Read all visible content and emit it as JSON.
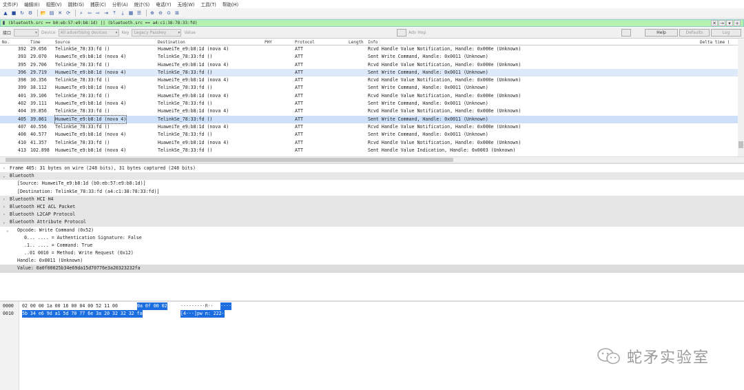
{
  "menu": [
    "文件(F)",
    "编辑(E)",
    "视图(V)",
    "跳转(G)",
    "捕获(C)",
    "分析(A)",
    "统计(S)",
    "电话(Y)",
    "无线(W)",
    "工具(T)",
    "帮助(H)"
  ],
  "filter": {
    "text": "(bluetooth.src == b0:eb:57:e9:b8:1d) || (bluetooth.src == a4:c1:38:78:33:fd)"
  },
  "btbar": {
    "interface_label": "接口",
    "device_label": "Device",
    "device_value": "All advertising devices",
    "key_label": "Key",
    "key_value": "Legacy Passkey",
    "value_label": "Value",
    "adv_hop_label": "Adv Hop",
    "help_label": "Help",
    "defaults_label": "Defaults",
    "log_label": "Log"
  },
  "columns": {
    "no": "No.",
    "time": "Time",
    "source": "Source",
    "destination": "Destination",
    "phy": "PHY",
    "protocol": "Protocol",
    "length": "Length",
    "info": "Info",
    "delta": "Delta time ("
  },
  "packets": [
    {
      "no": "392",
      "time": "29.056",
      "src": "TelinkSe_78:33:fd ()",
      "dst": "HuaweiTe_e9:b8:1d (nova 4)",
      "proto": "ATT",
      "info": "Rcvd Handle Value Notification, Handle: 0x000e (Unknown)",
      "state": "normal"
    },
    {
      "no": "393",
      "time": "29.070",
      "src": "HuaweiTe_e9:b8:1d (nova 4)",
      "dst": "TelinkSe_78:33:fd ()",
      "proto": "ATT",
      "info": "Sent Write Command, Handle: 0x0011 (Unknown)",
      "state": "normal"
    },
    {
      "no": "395",
      "time": "29.706",
      "src": "TelinkSe_78:33:fd ()",
      "dst": "HuaweiTe_e9:b8:1d (nova 4)",
      "proto": "ATT",
      "info": "Rcvd Handle Value Notification, Handle: 0x000e (Unknown)",
      "state": "normal"
    },
    {
      "no": "396",
      "time": "29.719",
      "src": "HuaweiTe_e9:b8:1d (nova 4)",
      "dst": "TelinkSe_78:33:fd ()",
      "proto": "ATT",
      "info": "Sent Write Command, Handle: 0x0011 (Unknown)",
      "state": "related"
    },
    {
      "no": "398",
      "time": "30.356",
      "src": "TelinkSe_78:33:fd ()",
      "dst": "HuaweiTe_e9:b8:1d (nova 4)",
      "proto": "ATT",
      "info": "Rcvd Handle Value Notification, Handle: 0x000e (Unknown)",
      "state": "normal"
    },
    {
      "no": "399",
      "time": "38.112",
      "src": "HuaweiTe_e9:b8:1d (nova 4)",
      "dst": "TelinkSe_78:33:fd ()",
      "proto": "ATT",
      "info": "Sent Write Command, Handle: 0x0011 (Unknown)",
      "state": "normal"
    },
    {
      "no": "401",
      "time": "39.106",
      "src": "TelinkSe_78:33:fd ()",
      "dst": "HuaweiTe_e9:b8:1d (nova 4)",
      "proto": "ATT",
      "info": "Rcvd Handle Value Notification, Handle: 0x000e (Unknown)",
      "state": "normal"
    },
    {
      "no": "402",
      "time": "39.111",
      "src": "HuaweiTe_e9:b8:1d (nova 4)",
      "dst": "TelinkSe_78:33:fd ()",
      "proto": "ATT",
      "info": "Sent Write Command, Handle: 0x0011 (Unknown)",
      "state": "normal"
    },
    {
      "no": "404",
      "time": "39.856",
      "src": "TelinkSe_78:33:fd ()",
      "dst": "HuaweiTe_e9:b8:1d (nova 4)",
      "proto": "ATT",
      "info": "Rcvd Handle Value Notification, Handle: 0x000e (Unknown)",
      "state": "normal"
    },
    {
      "no": "405",
      "time": "39.861",
      "src": "HuaweiTe_e9:b8:1d (nova 4)",
      "dst": "TelinkSe_78:33:fd ()",
      "proto": "ATT",
      "info": "Sent Write Command, Handle: 0x0011 (Unknown)",
      "state": "selected"
    },
    {
      "no": "407",
      "time": "40.556",
      "src": "TelinkSe_78:33:fd ()",
      "dst": "HuaweiTe_e9:b8:1d (nova 4)",
      "proto": "ATT",
      "info": "Rcvd Handle Value Notification, Handle: 0x000e (Unknown)",
      "state": "normal"
    },
    {
      "no": "408",
      "time": "40.577",
      "src": "HuaweiTe_e9:b8:1d (nova 4)",
      "dst": "TelinkSe_78:33:fd ()",
      "proto": "ATT",
      "info": "Sent Write Command, Handle: 0x0011 (Unknown)",
      "state": "normal"
    },
    {
      "no": "410",
      "time": "41.357",
      "src": "TelinkSe_78:33:fd ()",
      "dst": "HuaweiTe_e9:b8:1d (nova 4)",
      "proto": "ATT",
      "info": "Rcvd Handle Value Notification, Handle: 0x000e (Unknown)",
      "state": "normal"
    },
    {
      "no": "413",
      "time": "102.898",
      "src": "HuaweiTe_e9:b8:1d (nova 4)",
      "dst": "TelinkSe_78:33:fd ()",
      "proto": "ATT",
      "info": "Sent Handle Value Indication, Handle: 0x0003 (Unknown)",
      "state": "normal"
    }
  ],
  "details": [
    {
      "text": "Frame 405: 31 bytes on wire (248 bits), 31 bytes captured (248 bits)",
      "indent": 0,
      "arrow": ">",
      "style": "normal"
    },
    {
      "text": "Bluetooth",
      "indent": 0,
      "arrow": "v",
      "style": "hl"
    },
    {
      "text": "[Source: HuaweiTe_e9:b8:1d (b0:eb:57:e9:b8:1d)]",
      "indent": 1,
      "arrow": "",
      "style": "normal"
    },
    {
      "text": "[Destination: TelinkSe_78:33:fd (a4:c1:38:78:33:fd)]",
      "indent": 1,
      "arrow": "",
      "style": "normal"
    },
    {
      "text": "Bluetooth HCI H4",
      "indent": 0,
      "arrow": ">",
      "style": "hl"
    },
    {
      "text": "Bluetooth HCI ACL Packet",
      "indent": 0,
      "arrow": ">",
      "style": "hl"
    },
    {
      "text": "Bluetooth L2CAP Protocol",
      "indent": 0,
      "arrow": ">",
      "style": "hl"
    },
    {
      "text": "Bluetooth Attribute Protocol",
      "indent": 0,
      "arrow": "v",
      "style": "hl"
    },
    {
      "text": "Opcode: Write Command (0x52)",
      "indent": 1,
      "arrow": "v",
      "style": "normal"
    },
    {
      "text": "0... .... = Authentication Signature: False",
      "indent": 3,
      "arrow": "",
      "style": "normal"
    },
    {
      "text": ".1.. .... = Command: True",
      "indent": 3,
      "arrow": "",
      "style": "normal"
    },
    {
      "text": "..01 0010 = Method: Write Request (0x12)",
      "indent": 3,
      "arrow": "",
      "style": "normal"
    },
    {
      "text": "Handle: 0x0011 (Unknown)",
      "indent": 1,
      "arrow": "",
      "style": "normal"
    },
    {
      "text": "Value: 0a0f00025b34e69da15d70776e3a20323232fa",
      "indent": 1,
      "arrow": "",
      "style": "sel"
    }
  ],
  "bytes": [
    {
      "offset": "0000",
      "hex_plain": "02 00 00 1a 00 16 00 04  00 52 11 00",
      "hex_hl": "0a 0f 00 02",
      "ascii_plain": "·········R··",
      "ascii_hl": "····"
    },
    {
      "offset": "0010",
      "hex_plain": "",
      "hex_hl": "5b 34 e6 9d a1 5d 70 77  6e 3a 20 32 32 32 fa",
      "ascii_plain": "",
      "ascii_hl": "[4···]pw n: 222·"
    }
  ],
  "watermark": "蛇矛实验室",
  "colors": {
    "filter_bg": "#b5f2b0",
    "selected_row": "#cde0f7",
    "byte_highlight": "#1c6ee0"
  }
}
